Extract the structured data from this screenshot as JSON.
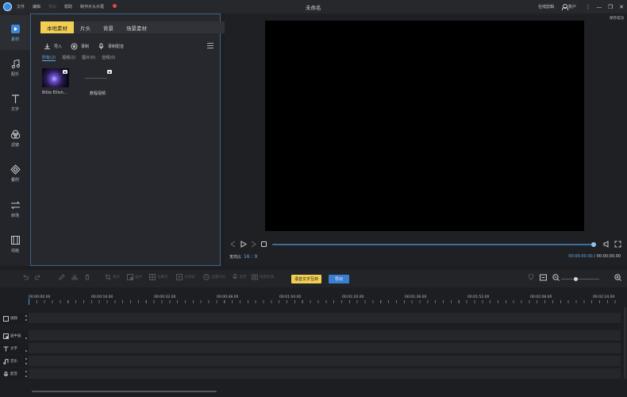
{
  "titlebar": {
    "menu": [
      "文件",
      "编辑",
      "导出",
      "帮助",
      "制作片头片尾"
    ],
    "window_title": "未命名",
    "online_editing": "在线剪辑",
    "account": "账户",
    "more_symbol": "⋮",
    "minimize_symbol": "—",
    "restore_symbol": "❐",
    "close_symbol": "✕"
  },
  "rail": {
    "items": [
      {
        "label": "素材",
        "icon": "film-icon"
      },
      {
        "label": "配乐",
        "icon": "music-icon"
      },
      {
        "label": "文字",
        "icon": "text-icon"
      },
      {
        "label": "滤镜",
        "icon": "filter-icon"
      },
      {
        "label": "叠附",
        "icon": "overlay-icon"
      },
      {
        "label": "转场",
        "icon": "transition-icon"
      },
      {
        "label": "动画",
        "icon": "animation-icon"
      }
    ]
  },
  "media": {
    "tabs": [
      "本地素材",
      "片头",
      "背景",
      "场景素材"
    ],
    "tools": [
      "导入",
      "录制",
      "录制配音"
    ],
    "filters": [
      "所有(2)",
      "视频(2)",
      "图片(0)",
      "音频(0)"
    ],
    "assets": [
      {
        "name": "Billie Eilish..."
      },
      {
        "name": "教程视频"
      }
    ]
  },
  "preview": {
    "save_status": "保存成功",
    "ratio_label": "宽高比",
    "ratio_value": "16 : 9",
    "current_time": "00:00:00.00",
    "separator": "/",
    "total_time": "00:00:00.00"
  },
  "timeline_toolbar": {
    "tools": [
      "裁剪",
      "画中",
      "马赛克",
      "冻结帧",
      "设置时长",
      "配音",
      "场景检测"
    ],
    "voice_to_text": "语音文字互转",
    "export": "导出"
  },
  "ruler": {
    "labels": [
      "00:00:00.00",
      "00:00:16.00",
      "00:00:32.00",
      "00:00:48.00",
      "00:01:04.00",
      "00:01:20.00",
      "00:01:36.00",
      "00:01:52.00",
      "00:02:08.00",
      "00:02:24.00"
    ]
  },
  "tracks": [
    {
      "label": "视频",
      "icon": "video-track-icon"
    },
    {
      "label": "画中画",
      "icon": "pip-track-icon"
    },
    {
      "label": "文字",
      "icon": "text-track-icon"
    },
    {
      "label": "音乐",
      "icon": "music-track-icon"
    },
    {
      "label": "配音",
      "icon": "voice-track-icon"
    }
  ],
  "colors": {
    "accent_yellow": "#f2ce52",
    "accent_blue": "#3a7fd1",
    "highlight_blue": "#6aa8e8"
  }
}
